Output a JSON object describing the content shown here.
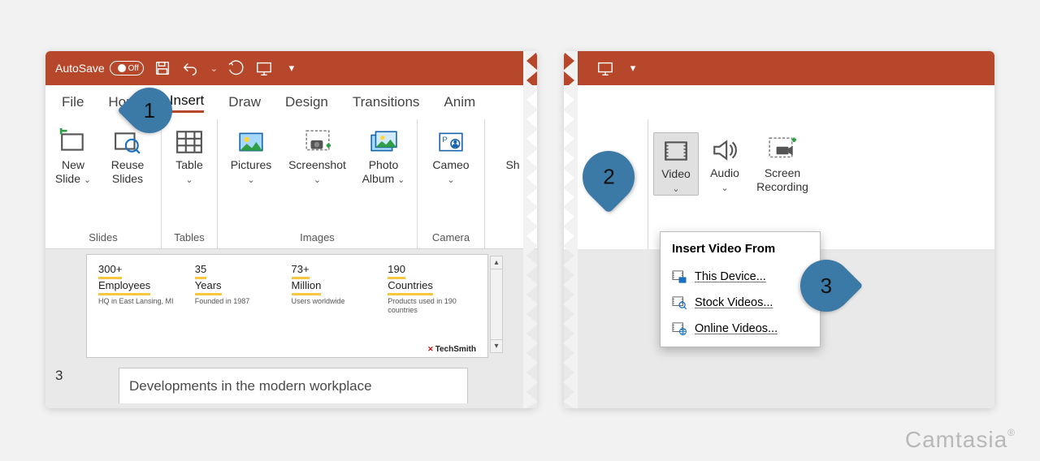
{
  "autosave": {
    "label": "AutoSave",
    "state": "Off"
  },
  "tabs": [
    "File",
    "Home",
    "Insert",
    "Draw",
    "Design",
    "Transitions",
    "Anim"
  ],
  "active_tab": "Insert",
  "groups": {
    "slides": {
      "label": "Slides",
      "new_slide": "New Slide",
      "reuse": "Reuse Slides"
    },
    "tables": {
      "label": "Tables",
      "table": "Table"
    },
    "images": {
      "label": "Images",
      "pictures": "Pictures",
      "screenshot": "Screenshot",
      "album": "Photo Album"
    },
    "camera": {
      "label": "Camera",
      "cameo": "Cameo"
    },
    "shapes": {
      "shapes": "Sh"
    }
  },
  "right_groups": {
    "media": {
      "video": "Video",
      "audio": "Audio",
      "screenrec": "Screen Recording"
    }
  },
  "dropdown": {
    "header": "Insert Video From",
    "items": [
      "This Device...",
      "Stock Videos...",
      "Online Videos..."
    ]
  },
  "slide": {
    "stats": [
      {
        "big1": "300+",
        "big2": "Employees",
        "sub": "HQ in East Lansing, MI"
      },
      {
        "big1": "35",
        "big2": "Years",
        "sub": "Founded in 1987"
      },
      {
        "big1": "73+",
        "big2": "Million",
        "sub": "Users worldwide"
      },
      {
        "big1": "190",
        "big2": "Countries",
        "sub": "Products used in 190 countries"
      }
    ],
    "brand": "TechSmith",
    "number": "3",
    "next_title": "Developments in the modern workplace"
  },
  "annotations": {
    "a1": "1",
    "a2": "2",
    "a3": "3"
  },
  "watermark": "Camtasia"
}
